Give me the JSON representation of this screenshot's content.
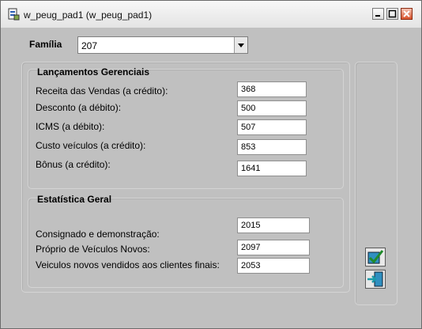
{
  "window": {
    "title": "w_peug_pad1 (w_peug_pad1)"
  },
  "familia": {
    "label": "Família",
    "value": "207"
  },
  "lancamentos": {
    "title": "Lançamentos Gerenciais",
    "rows": [
      {
        "label": "Receita das Vendas (a crédito):",
        "value": "368"
      },
      {
        "label": "Desconto (a débito):",
        "value": "500"
      },
      {
        "label": "ICMS (a débito):",
        "value": "507"
      },
      {
        "label": "Custo veículos (a crédito):",
        "value": "853"
      },
      {
        "label": "Bônus (a crédito):",
        "value": "1641"
      }
    ]
  },
  "estatistica": {
    "title": "Estatística Geral",
    "rows": [
      {
        "label": "Consignado e demonstração:",
        "value": "2015"
      },
      {
        "label": "Próprio de Veículos Novos:",
        "value": "2097"
      },
      {
        "label": "Veiculos novos vendidos aos clientes finais:",
        "value": "2053"
      }
    ]
  },
  "icons": {
    "confirm": "check-icon",
    "exit": "exit-door-icon",
    "app": "app-icon"
  }
}
